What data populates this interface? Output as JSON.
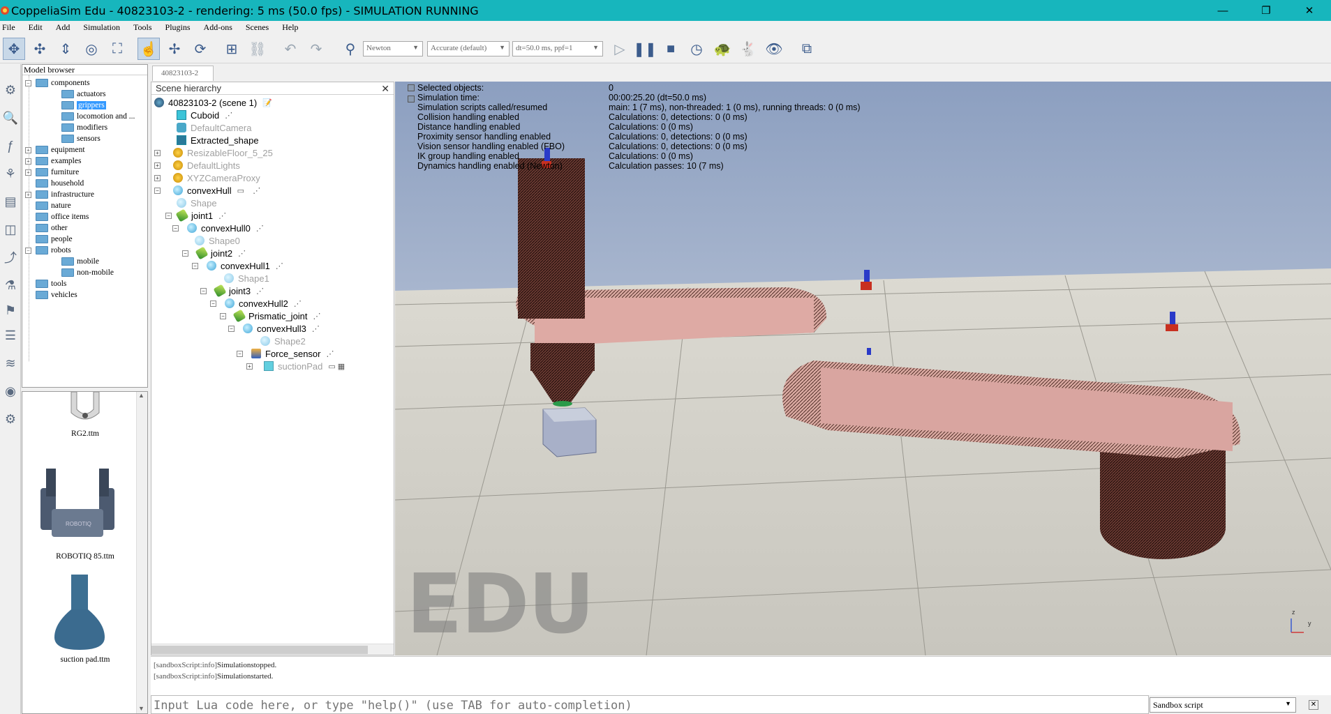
{
  "window": {
    "title": "CoppeliaSim Edu - 40823103-2 - rendering: 5 ms (50.0 fps) - SIMULATION RUNNING",
    "minimize": "—",
    "maximize": "❐",
    "close": "✕"
  },
  "menubar": [
    "File",
    "Edit",
    "Add",
    "Simulation",
    "Tools",
    "Plugins",
    "Add-ons",
    "Scenes",
    "Help"
  ],
  "toolbar": {
    "engine": "Newton",
    "accuracy": "Accurate (default)",
    "timestep": "dt=50.0 ms, ppf=1"
  },
  "model_browser": {
    "title": "Model browser",
    "items": [
      {
        "label": "components",
        "expander": "−"
      },
      {
        "label": "actuators"
      },
      {
        "label": "grippers",
        "selected": true
      },
      {
        "label": "locomotion and ..."
      },
      {
        "label": "modifiers"
      },
      {
        "label": "sensors"
      },
      {
        "label": "equipment",
        "expander": "+"
      },
      {
        "label": "examples",
        "expander": "+"
      },
      {
        "label": "furniture",
        "expander": "+"
      },
      {
        "label": "household"
      },
      {
        "label": "infrastructure",
        "expander": "+"
      },
      {
        "label": "nature"
      },
      {
        "label": "office items"
      },
      {
        "label": "other"
      },
      {
        "label": "people"
      },
      {
        "label": "robots",
        "expander": "−"
      },
      {
        "label": "mobile"
      },
      {
        "label": "non-mobile"
      },
      {
        "label": "tools"
      },
      {
        "label": "vehicles"
      }
    ],
    "thumbnails": [
      "RG2.ttm",
      "ROBOTIQ 85.ttm",
      "suction pad.ttm"
    ]
  },
  "scene_tab": "40823103-2",
  "scene_hierarchy": {
    "title": "Scene hierarchy",
    "rows": [
      {
        "label": "40823103-2 (scene 1)"
      },
      {
        "label": "Cuboid"
      },
      {
        "label": "DefaultCamera"
      },
      {
        "label": "Extracted_shape"
      },
      {
        "label": "ResizableFloor_5_25"
      },
      {
        "label": "DefaultLights"
      },
      {
        "label": "XYZCameraProxy"
      },
      {
        "label": "convexHull"
      },
      {
        "label": "Shape"
      },
      {
        "label": "joint1"
      },
      {
        "label": "convexHull0"
      },
      {
        "label": "Shape0"
      },
      {
        "label": "joint2"
      },
      {
        "label": "convexHull1"
      },
      {
        "label": "Shape1"
      },
      {
        "label": "joint3"
      },
      {
        "label": "convexHull2"
      },
      {
        "label": "Prismatic_joint"
      },
      {
        "label": "convexHull3"
      },
      {
        "label": "Shape2"
      },
      {
        "label": "Force_sensor"
      },
      {
        "label": "suctionPad"
      }
    ]
  },
  "info": {
    "labels": [
      "Selected objects:",
      "Simulation time:",
      "Simulation scripts called/resumed",
      "Collision handling enabled",
      "Distance handling enabled",
      "Proximity sensor handling enabled",
      "Vision sensor handling enabled (FBO)",
      "IK group handling enabled",
      "Dynamics handling enabled (Newton)"
    ],
    "values": [
      "0",
      "00:00:25.20 (dt=50.0 ms)",
      "main: 1 (7 ms), non-threaded: 1 (0 ms), running threads: 0 (0 ms)",
      "Calculations: 0, detections: 0 (0 ms)",
      "Calculations: 0 (0 ms)",
      "Calculations: 0, detections: 0 (0 ms)",
      "Calculations: 0, detections: 0 (0 ms)",
      "Calculations: 0 (0 ms)",
      "Calculation passes: 10 (7 ms)"
    ]
  },
  "viewport": {
    "watermark": "EDU",
    "axis_z": "z",
    "axis_y": "y"
  },
  "console": {
    "lines": [
      {
        "tag": "[sandboxScript:info]",
        "text": "Simulationstopped."
      },
      {
        "tag": "[sandboxScript:info]",
        "text": "Simulationstarted."
      }
    ],
    "input_placeholder": "Input Lua code here, or type \"help()\" (use TAB for auto-completion)",
    "script_select": "Sandbox script",
    "close": "✕"
  }
}
